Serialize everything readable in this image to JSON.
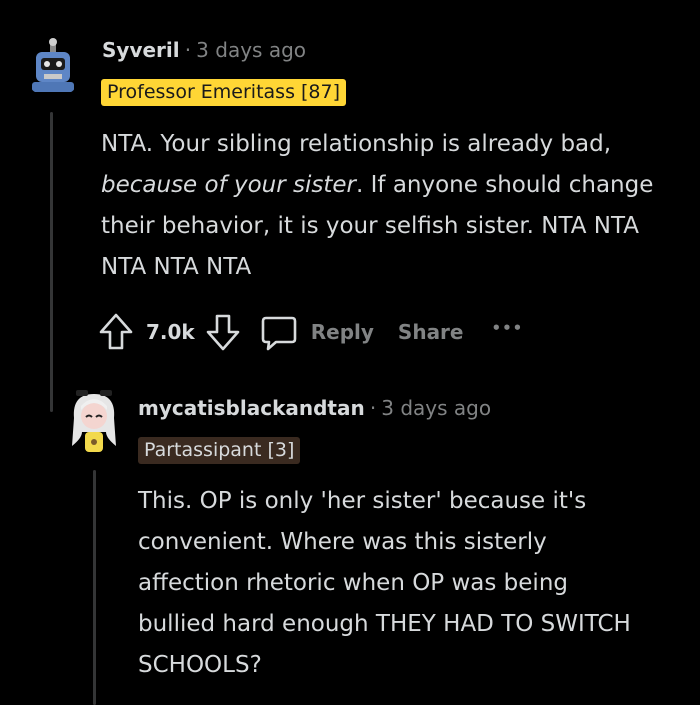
{
  "comments": [
    {
      "username": "Syveril",
      "separator": "·",
      "time": "3 days ago",
      "flair": "Professor Emeritass [87]",
      "body_parts": [
        {
          "text": "NTA. Your sibling relationship is already bad, ",
          "italic": false
        },
        {
          "text": "because of your sister",
          "italic": true
        },
        {
          "text": ". If anyone should change their behavior, it is your selfish sister. NTA NTA NTA NTA NTA",
          "italic": false
        }
      ],
      "votes": "7.0k",
      "reply_label": "Reply",
      "share_label": "Share",
      "more_label": "•••"
    },
    {
      "username": "mycatisblackandtan",
      "separator": "·",
      "time": "3 days ago",
      "flair": "Partassipant [3]",
      "body": "This. OP is only 'her sister' because it's convenient. Where was this sisterly affection rhetoric when OP was being bullied hard enough THEY HAD TO SWITCH SCHOOLS?"
    }
  ],
  "colors": {
    "background": "#000000",
    "text": "#d7dadc",
    "muted": "#818384",
    "flair_gold": "#ffd635",
    "flair_dark": "#3a2a20"
  }
}
